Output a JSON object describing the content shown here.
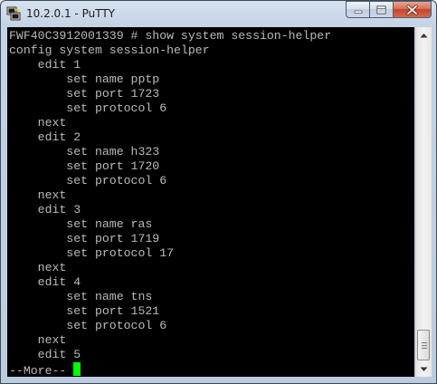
{
  "window": {
    "title": "10.2.0.1 - PuTTY",
    "icon": "putty-app-icon",
    "buttons": [
      "minimize",
      "maximize",
      "close"
    ]
  },
  "terminal": {
    "lines": [
      "FWF40C3912001339 # show system session-helper",
      "config system session-helper",
      "    edit 1",
      "        set name pptp",
      "        set port 1723",
      "        set protocol 6",
      "    next",
      "    edit 2",
      "        set name h323",
      "        set port 1720",
      "        set protocol 6",
      "    next",
      "    edit 3",
      "        set name ras",
      "        set port 1719",
      "        set protocol 17",
      "    next",
      "    edit 4",
      "        set name tns",
      "        set port 1521",
      "        set protocol 6",
      "    next",
      "    edit 5"
    ],
    "pager_prompt": "--More-- ",
    "text_color": "#bbbbbb",
    "background_color": "#000000",
    "cursor_color": "#00ff00"
  },
  "scrollbar": {
    "up_icon": "scroll-up-arrow-icon",
    "down_icon": "scroll-down-arrow-icon"
  }
}
